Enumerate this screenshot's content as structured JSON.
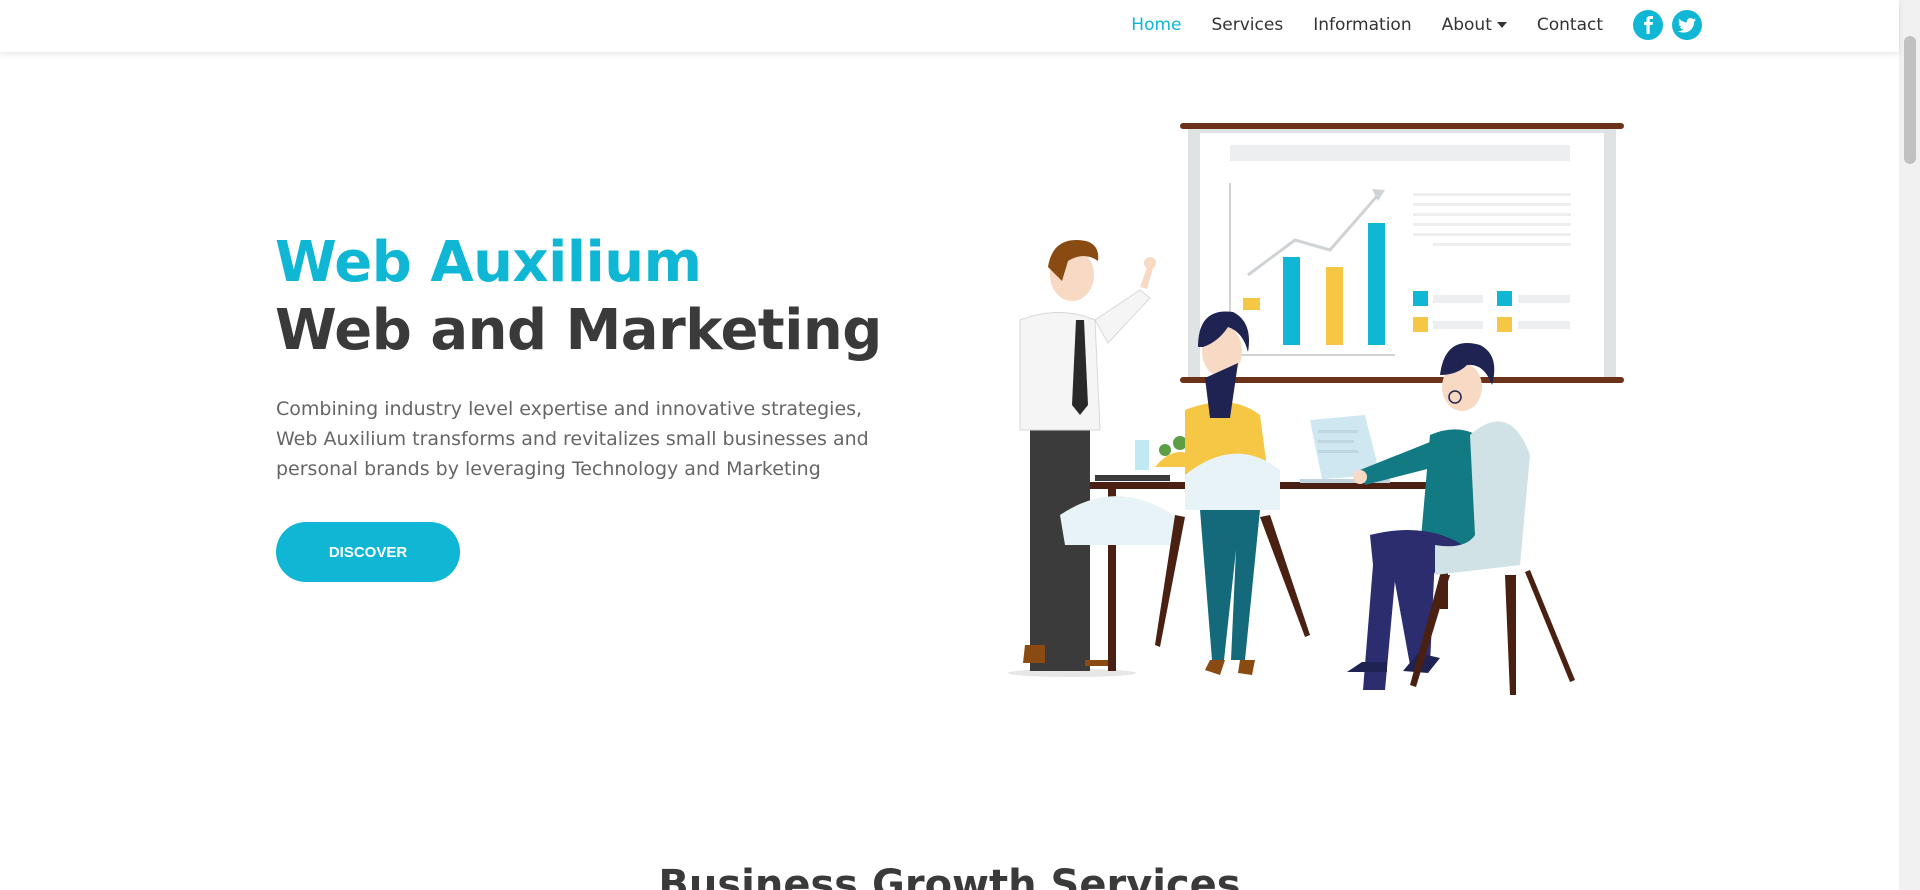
{
  "nav": {
    "items": [
      {
        "label": "Home",
        "active": true
      },
      {
        "label": "Services",
        "active": false
      },
      {
        "label": "Information",
        "active": false
      },
      {
        "label": "About",
        "active": false,
        "dropdown": true
      },
      {
        "label": "Contact",
        "active": false
      }
    ],
    "social": [
      {
        "icon": "facebook-icon",
        "glyph": "f"
      },
      {
        "icon": "twitter-icon",
        "glyph": ""
      }
    ]
  },
  "hero": {
    "title_brand": "Web Auxilium",
    "title_main": "Web and Marketing",
    "description": "Combining industry level expertise and innovative strategies, Web Auxilium transforms and revitalizes small businesses and personal brands by leveraging Technology and Marketing",
    "cta_label": "DISCOVER",
    "illustration_icon": "business-meeting-illustration"
  },
  "section": {
    "title": "Business Growth Services"
  },
  "colors": {
    "accent": "#0fb7d4",
    "heading": "#3a3a3a",
    "body_text": "#666666"
  }
}
